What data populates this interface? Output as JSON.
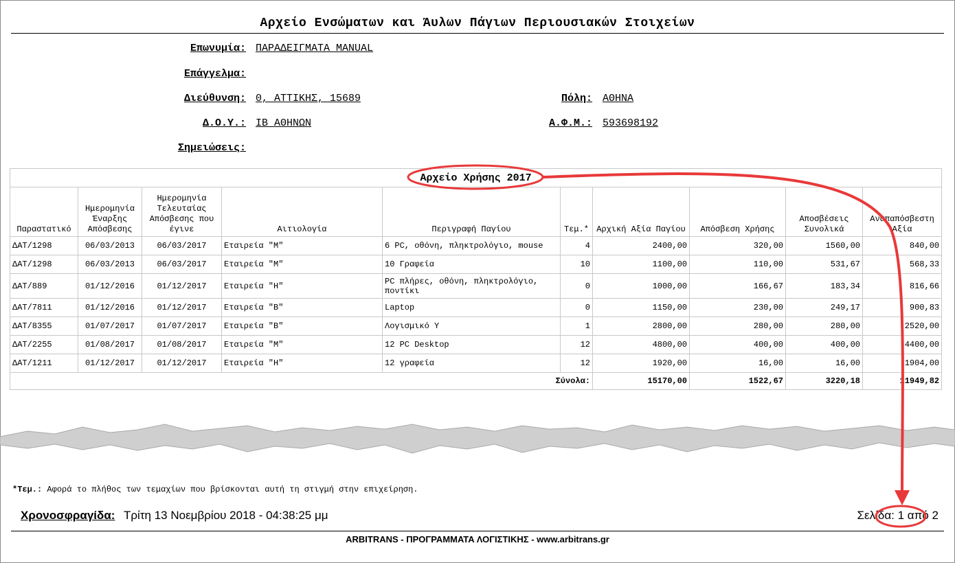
{
  "title": "Αρχείο Ενσώματων και Άυλων Πάγιων Περιουσιακών Στοιχείων",
  "company": {
    "name_label": "Επωνυμία:",
    "name": "ΠΑΡΑΔΕΙΓΜΑΤΑ MANUAL",
    "profession_label": "Επάγγελμα:",
    "address_label": "Διεύθυνση:",
    "address": "0, ΑΤΤΙΚΗΣ, 15689",
    "city_label": "Πόλη:",
    "city": "ΑΘΗΝΑ",
    "tax_office_label": "Δ.Ο.Υ.:",
    "tax_office": "ΙΒ ΑΘΗΝΩΝ",
    "vat_label": "Α.Φ.Μ.:",
    "vat": "593698192",
    "notes_label": "Σημειώσεις:"
  },
  "table": {
    "year_title": "Αρχείο Χρήσης 2017",
    "headers": {
      "doc": "Παραστατικό",
      "start": "Ημερομηνία Έναρξης Απόσβεσης",
      "last": "Ημερομηνία Τελευταίας Απόσβεσης που έγινε",
      "reason": "Αιτιολογία",
      "desc": "Περιγραφή Παγίου",
      "qty": "Τεμ.*",
      "initial": "Αρχική Αξία Παγίου",
      "dep_year": "Απόσβεση Χρήσης",
      "dep_total": "Αποσβέσεις Συνολικά",
      "remaining": "Αναπαπόσβεστη Αξία"
    },
    "rows": [
      {
        "doc": "ΔΑΤ/1298",
        "start": "06/03/2013",
        "last": "06/03/2017",
        "reason": "Εταιρεία \"Μ\"",
        "desc": "6 PC, οθόνη, πληκτρολόγιο, mouse",
        "qty": "4",
        "initial": "2400,00",
        "dep_year": "320,00",
        "dep_total": "1560,00",
        "remaining": "840,00"
      },
      {
        "doc": "ΔΑΤ/1298",
        "start": "06/03/2013",
        "last": "06/03/2017",
        "reason": "Εταιρεία \"Μ\"",
        "desc": "10 Γραφεία",
        "qty": "10",
        "initial": "1100,00",
        "dep_year": "110,00",
        "dep_total": "531,67",
        "remaining": "568,33"
      },
      {
        "doc": "ΔΑΤ/889",
        "start": "01/12/2016",
        "last": "01/12/2017",
        "reason": "Εταιρεία \"Η\"",
        "desc": "PC πλήρες, οθόνη, πληκτρολόγιο, ποντίκι",
        "qty": "0",
        "initial": "1000,00",
        "dep_year": "166,67",
        "dep_total": "183,34",
        "remaining": "816,66"
      },
      {
        "doc": "ΔΑΤ/7811",
        "start": "01/12/2016",
        "last": "01/12/2017",
        "reason": "Εταιρεία \"Β\"",
        "desc": "Laptop",
        "qty": "0",
        "initial": "1150,00",
        "dep_year": "230,00",
        "dep_total": "249,17",
        "remaining": "900,83"
      },
      {
        "doc": "ΔΑΤ/8355",
        "start": "01/07/2017",
        "last": "01/07/2017",
        "reason": "Εταιρεία \"Β\"",
        "desc": "Λογισμικό Υ",
        "qty": "1",
        "initial": "2800,00",
        "dep_year": "280,00",
        "dep_total": "280,00",
        "remaining": "2520,00"
      },
      {
        "doc": "ΔΑΤ/2255",
        "start": "01/08/2017",
        "last": "01/08/2017",
        "reason": "Εταιρεία \"Μ\"",
        "desc": "12 PC Desktop",
        "qty": "12",
        "initial": "4800,00",
        "dep_year": "400,00",
        "dep_total": "400,00",
        "remaining": "4400,00"
      },
      {
        "doc": "ΔΑΤ/1211",
        "start": "01/12/2017",
        "last": "01/12/2017",
        "reason": "Εταιρεία \"Η\"",
        "desc": "12 γραφεία",
        "qty": "12",
        "initial": "1920,00",
        "dep_year": "16,00",
        "dep_total": "16,00",
        "remaining": "1904,00"
      }
    ],
    "totals": {
      "label": "Σύνολα:",
      "initial": "15170,00",
      "dep_year": "1522,67",
      "dep_total": "3220,18",
      "remaining": "11949,82"
    }
  },
  "note": {
    "prefix": "*Τεμ.:",
    "text": " Αφορά το πλήθος των τεμαχίων που βρίσκονται αυτή τη στιγμή στην επιχείρηση."
  },
  "timestamp": {
    "label": "Χρονοσφραγίδα:",
    "value": "Τρίτη 13 Νοεμβρίου 2018 - 04:38:25 μμ"
  },
  "page_info": "Σελίδα: 1 από 2",
  "footer": "ARBITRANS - ΠΡΟΓΡΑΜΜΑΤΑ ΛΟΓΙΣΤΙΚΗΣ -  www.arbitrans.gr",
  "colors": {
    "annotation": "#e8393a",
    "torn_edge": "#cfcfcf"
  }
}
